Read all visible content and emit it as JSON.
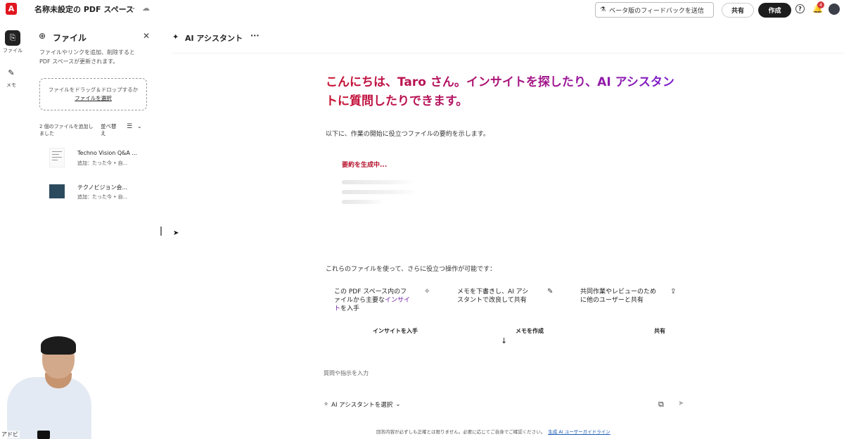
{
  "app": {
    "space_title": "名称未設定の PDF スペース",
    "beta_feedback": "ベータ版のフィードバックを送信",
    "share_label": "共有",
    "create_label": "作成",
    "notification_count": "4"
  },
  "rail": {
    "files_label": "ファイル",
    "memo_label": "メモ"
  },
  "files_panel": {
    "title": "ファイル",
    "description": "ファイルやリンクを追加、削除すると PDF スペースが更新されます。",
    "dropzone_text": "ファイルをドラッグ＆ドロップするか",
    "dropzone_link": "ファイルを選択",
    "files_added": "2 個のファイルを追加しました",
    "sort_label": "並べ替え",
    "files": [
      {
        "name": "Techno Vision Q&A ...",
        "meta": "追加：たった今 • 自..."
      },
      {
        "name": "テクノビジョン会...",
        "meta": "追加：たった今 • 自..."
      }
    ]
  },
  "assistant": {
    "header_title": "AI アシスタント",
    "greeting": "こんにちは、Taro さん。インサイトを探したり、AI アシスタントに質問したりできます。",
    "subtext": "以下に、作業の開始に役立つファイルの要約を示します。",
    "generating": "要約を生成中...",
    "ops_intro": "これらのファイルを使って、さらに役立つ操作が可能です：",
    "cards": [
      {
        "text_before": "この PDF スペース内のファイルから主要な",
        "highlight": "インサイト",
        "text_after": "を入手",
        "action": "インサイトを入手"
      },
      {
        "text_before": "メモを下書きし、AI アシスタントで改良して共有",
        "highlight": "",
        "text_after": "",
        "action": "メモを作成"
      },
      {
        "text_before": "共同作業やレビューのために他のユーザーと共有",
        "highlight": "",
        "text_after": "",
        "action": "共有"
      }
    ],
    "input_placeholder": "質問や指示を入力",
    "select_assistant": "AI アシスタントを選択",
    "footer_note": "回答内容が必ずしも正確とは限りません。必要に応じてご自身でご確認ください。",
    "footer_link": "生成 AI ユーザーガイドライン"
  },
  "webcam": {
    "label": "アドビ"
  }
}
